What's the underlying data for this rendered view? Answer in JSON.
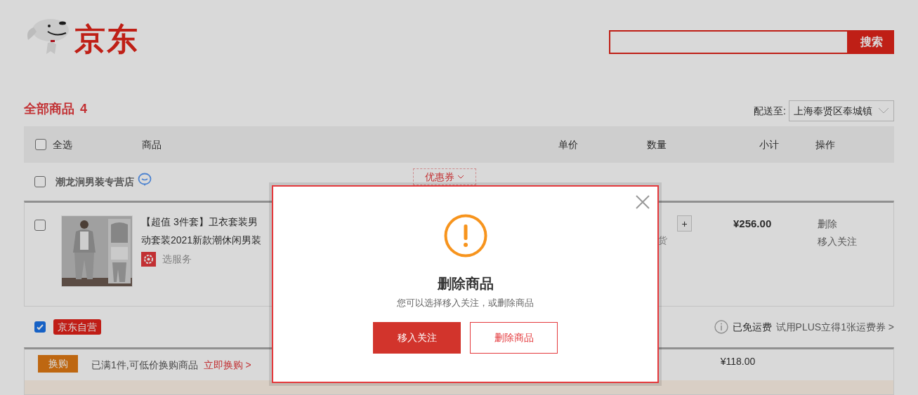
{
  "header": {
    "logo_text": "京东",
    "search_button": "搜索"
  },
  "cart": {
    "title": "全部商品",
    "count": "4",
    "delivery_label": "配送至:",
    "delivery_address": "上海奉贤区奉城镇"
  },
  "select_all": {
    "label": "全选",
    "checked": false
  },
  "columns": [
    "商品",
    "单价",
    "数量",
    "小计",
    "操作"
  ],
  "shops": [
    {
      "kind": "store",
      "name": "潮龙涧男装专营店",
      "checked": false,
      "coupon": "优惠券",
      "items": [
        {
          "checked": false,
          "title_lines": [
            "【超值 3件套】卫衣套装男",
            "动套装2021新款潮休闲男装"
          ],
          "service": "选服务",
          "qty_button": "+",
          "stock": "货",
          "subtotal": "¥256.00",
          "actions": [
            "删除",
            "移入关注"
          ]
        }
      ]
    },
    {
      "kind": "self",
      "name": "京东自营",
      "checked": true,
      "shipping_note": "已免运费",
      "plus_offer": "试用PLUS立得1张运费券 >",
      "promo": {
        "tag": "换购",
        "text": "已满1件,可低价换购商品",
        "link": "立即换购 >"
      },
      "subtotal": "¥118.00"
    }
  ],
  "dialog": {
    "title": "删除商品",
    "message": "您可以选择移入关注，或删除商品",
    "buttons": [
      {
        "label": "移入关注",
        "kind": "primary"
      },
      {
        "label": "删除商品",
        "kind": "secondary"
      }
    ]
  }
}
